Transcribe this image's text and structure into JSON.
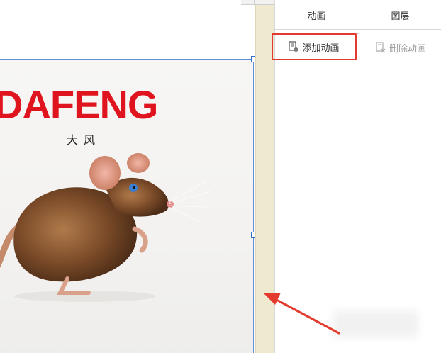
{
  "canvas": {
    "image_title": "DAFENG",
    "image_subtitle": "大风"
  },
  "panel": {
    "tabs": [
      {
        "label": "动画",
        "active": true
      },
      {
        "label": "图层",
        "active": false
      }
    ],
    "toolbar": {
      "add_label": "添加动画",
      "delete_label": "删除动画",
      "delete_enabled": false
    }
  },
  "colors": {
    "title_red": "#e0141e",
    "highlight_red": "#e23a2e",
    "selection_blue": "#2f6fd0",
    "splitter": "#efe9cf"
  },
  "icons": {
    "add_button": "add-animation-icon",
    "delete_button": "delete-animation-icon"
  }
}
